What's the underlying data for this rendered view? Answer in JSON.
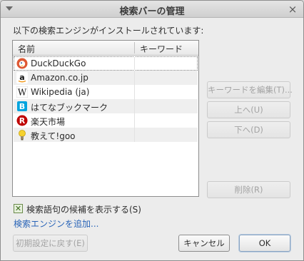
{
  "window": {
    "title": "検索バーの管理",
    "menu_icon": "menu-arrow-icon",
    "close_glyph": "×"
  },
  "intro": "以下の検索エンジンがインストールされています:",
  "list": {
    "columns": [
      "名前",
      "キーワード"
    ],
    "rows": [
      {
        "name": "DuckDuckGo",
        "keyword": "",
        "icon": "duckduckgo-icon"
      },
      {
        "name": "Amazon.co.jp",
        "keyword": "",
        "icon": "amazon-icon"
      },
      {
        "name": "Wikipedia (ja)",
        "keyword": "",
        "icon": "wikipedia-icon"
      },
      {
        "name": "はてなブックマーク",
        "keyword": "",
        "icon": "hatena-icon"
      },
      {
        "name": "楽天市場",
        "keyword": "",
        "icon": "rakuten-icon"
      },
      {
        "name": "教えて!goo",
        "keyword": "",
        "icon": "goo-icon"
      }
    ]
  },
  "buttons": {
    "edit_keyword": "キーワードを編集(T)...",
    "move_up": "上へ(U)",
    "move_down": "下へ(D)",
    "remove": "削除(R)",
    "restore_defaults": "初期設定に戻す(E)",
    "cancel": "キャンセル",
    "ok": "OK"
  },
  "suggestions": {
    "label": "検索語句の候補を表示する(S)",
    "checked": true,
    "check_glyph": "✕"
  },
  "add_engines_link": "検索エンジンを追加...",
  "colors": {
    "link": "#2a65b8",
    "duckduckgo": "#de5833",
    "hatena": "#00a4de",
    "rakuten": "#bf0000"
  }
}
